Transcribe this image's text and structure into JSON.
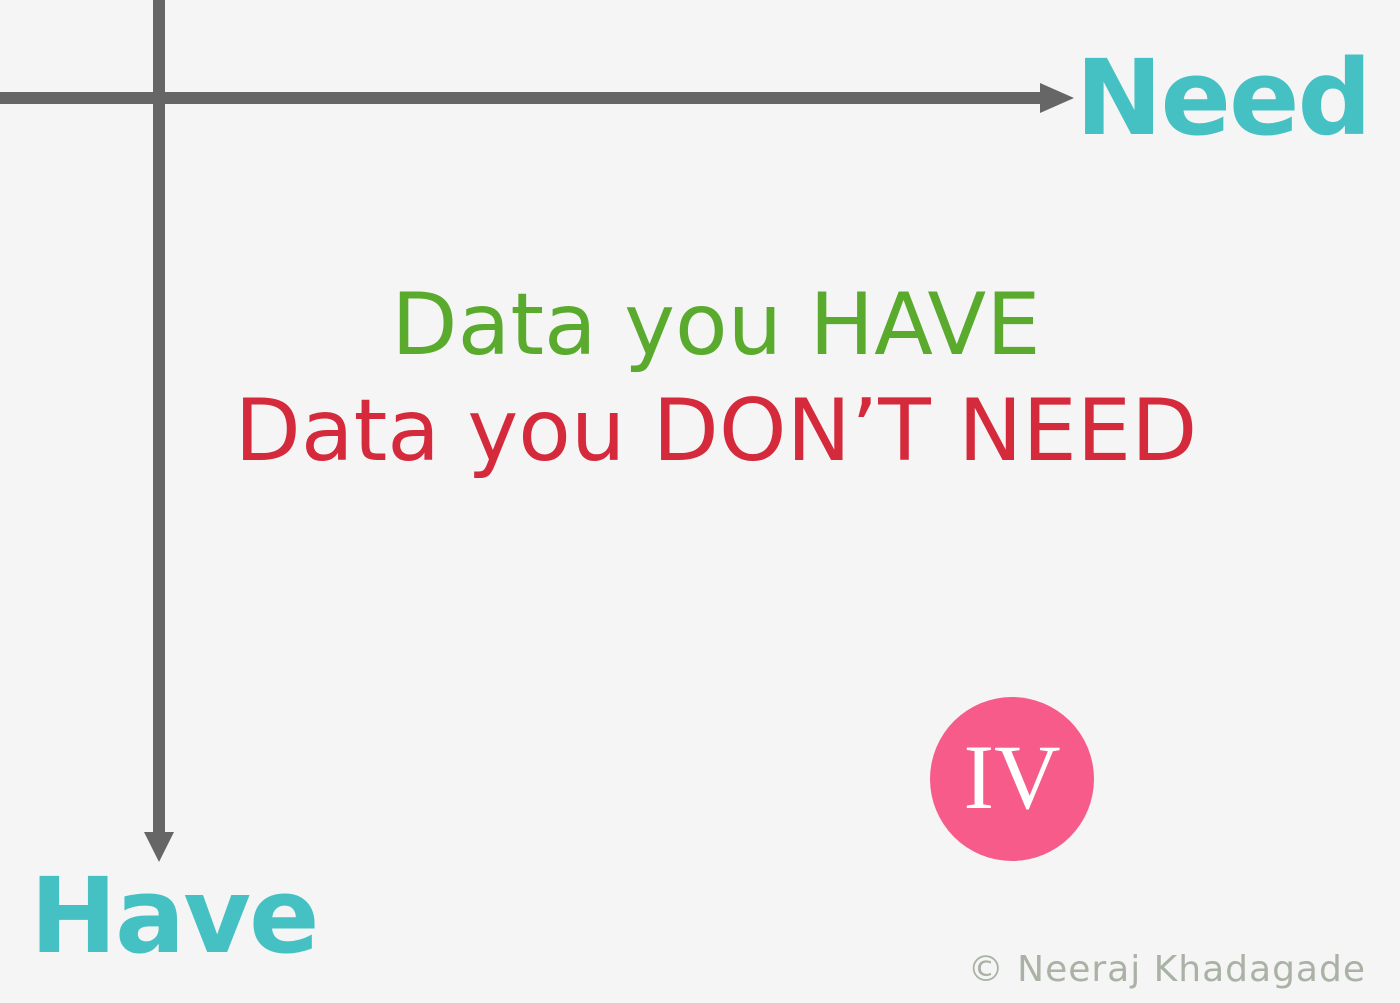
{
  "axes": {
    "horizontal_label": "Need",
    "vertical_label": "Have",
    "label_color": "#45c1c4",
    "line_color": "#666666"
  },
  "quadrant": {
    "line1": "Data you HAVE",
    "line1_color": "#5aaa2e",
    "line2": "Data you DON’T NEED",
    "line2_color": "#d42a3c",
    "badge": "IV",
    "badge_color": "#f65b8a"
  },
  "footer": {
    "copyright": "© Neeraj Khadagade"
  }
}
